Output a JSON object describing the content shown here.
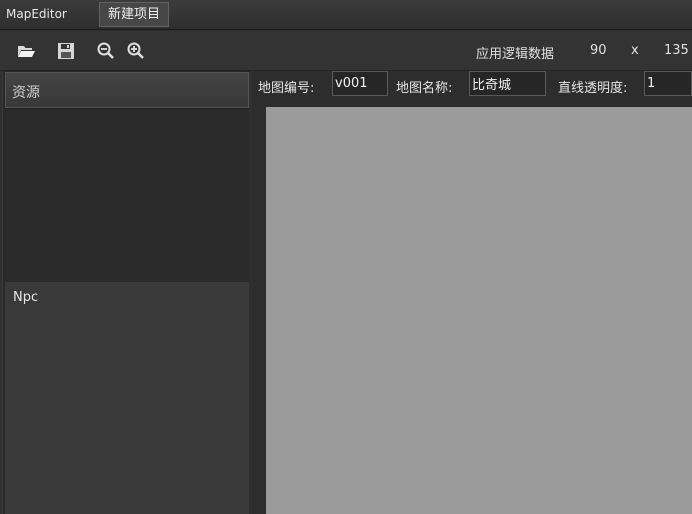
{
  "app": {
    "title": "MapEditor"
  },
  "menu": {
    "new_project": "新建项目"
  },
  "toolbar": {
    "icons": [
      "folder-open-icon",
      "save-icon",
      "zoom-out-icon",
      "zoom-in-icon"
    ],
    "apply_logic": "应用逻辑数据",
    "width": "90",
    "separator": "x",
    "height": "135"
  },
  "panel": {
    "title": "资源",
    "npc_label": "Npc"
  },
  "map_fields": {
    "id_label": "地图编号:",
    "id_value": "v001",
    "name_label": "地图名称:",
    "name_value": "比奇城",
    "opacity_label": "直线透明度:",
    "opacity_value": "1"
  },
  "colors": {
    "canvas": "#9b9b9b",
    "background": "#2f2f2f"
  }
}
